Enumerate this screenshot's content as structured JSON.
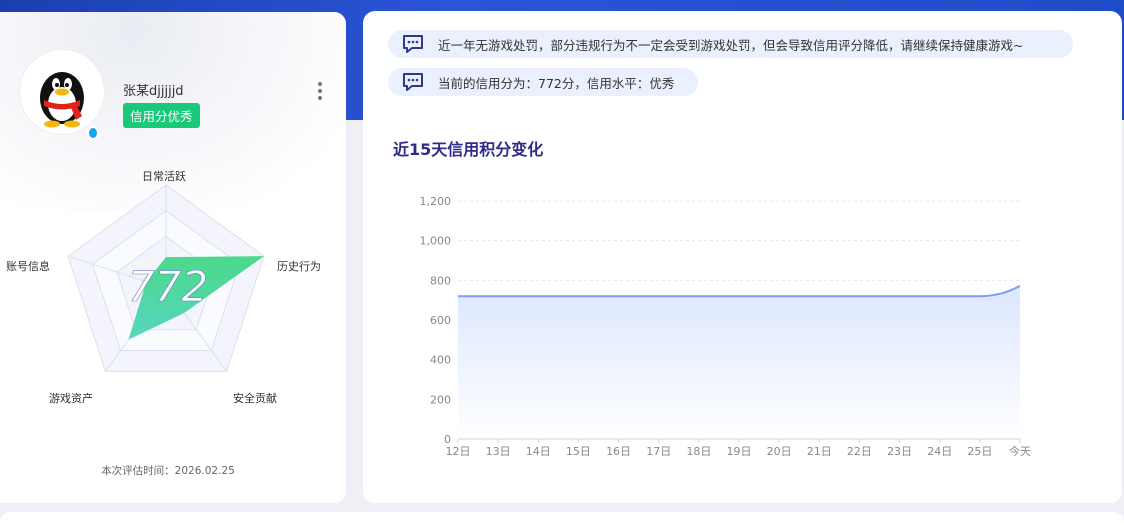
{
  "profile": {
    "username": "张某djjjjjd",
    "badge": "信用分优秀",
    "eval_time": "本次评估时间：2026.02.25",
    "score": "772"
  },
  "radar": {
    "axes": [
      "日常活跃",
      "历史行为",
      "安全贡献",
      "游戏资产",
      "账号信息"
    ],
    "values": [
      0.3,
      1.0,
      0.3,
      0.62,
      0.2
    ],
    "fill_start": "#4cd98a",
    "fill_end": "#56d5c0"
  },
  "notices": [
    "近一年无游戏处罚，部分违规行为不一定会受到游戏处罚，但会导致信用评分降低，请继续保持健康游戏~",
    "当前的信用分为：772分，信用水平：优秀"
  ],
  "chart_title": "近15天信用积分变化",
  "chart_data": {
    "type": "area",
    "x": [
      "12日",
      "13日",
      "14日",
      "15日",
      "16日",
      "17日",
      "18日",
      "19日",
      "20日",
      "21日",
      "22日",
      "23日",
      "24日",
      "25日",
      "今天"
    ],
    "series": [
      {
        "values": [
          720,
          720,
          720,
          720,
          720,
          720,
          720,
          720,
          720,
          720,
          720,
          720,
          720,
          720,
          772
        ]
      }
    ],
    "yticks": [
      "0",
      "200",
      "400",
      "600",
      "800",
      "1,000",
      "1,200"
    ],
    "ylim": [
      0,
      1200
    ],
    "line_color": "#7b9ef3",
    "grid": true
  }
}
